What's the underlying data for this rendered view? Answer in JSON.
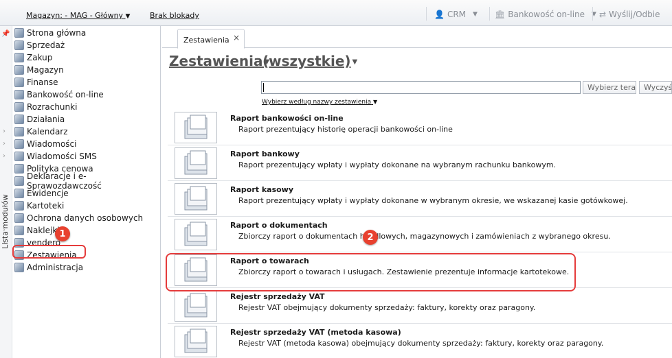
{
  "toolbar": {
    "warehouse_label": "Magazyn: - MAG - Główny",
    "lock_label": "Brak blokady",
    "crm_label": "CRM",
    "banking_label": "Bankowość on-line",
    "send_label": "Wyślij/Odbie"
  },
  "side_strip": {
    "label": "Lista modułów"
  },
  "sidebar": {
    "items": [
      {
        "label": "Strona główna"
      },
      {
        "label": "Sprzedaż"
      },
      {
        "label": "Zakup"
      },
      {
        "label": "Magazyn"
      },
      {
        "label": "Finanse"
      },
      {
        "label": "Bankowość on-line"
      },
      {
        "label": "Rozrachunki"
      },
      {
        "label": "Działania"
      },
      {
        "label": "Kalendarz"
      },
      {
        "label": "Wiadomości"
      },
      {
        "label": "Wiadomości SMS"
      },
      {
        "label": "Polityka cenowa"
      },
      {
        "label": "Deklaracje i e-Sprawozdawczość"
      },
      {
        "label": "Ewidencje"
      },
      {
        "label": "Kartoteki"
      },
      {
        "label": "Ochrona danych osobowych"
      },
      {
        "label": "Naklejki"
      },
      {
        "label": "vendero"
      },
      {
        "label": "Zestawienia"
      },
      {
        "label": "Administracja"
      }
    ]
  },
  "annotations": {
    "step1": "1",
    "step2": "2"
  },
  "tabs": {
    "active_label": "Zestawienia",
    "close_glyph": "×"
  },
  "header": {
    "title": "Zestawienia",
    "filter": "(wszystkie)"
  },
  "search": {
    "value": "",
    "select_button": "Wybierz teraz",
    "clear_button": "Wyczyść",
    "choose_by_name": "Wybierz według nazwy zestawienia"
  },
  "reports": [
    {
      "title": "Raport bankowości on-line",
      "desc": "Raport prezentujący historię operacji bankowości on-line"
    },
    {
      "title": "Raport bankowy",
      "desc": "Raport prezentujący wpłaty i wypłaty dokonane na wybranym rachunku bankowym."
    },
    {
      "title": "Raport kasowy",
      "desc": "Raport prezentujący wpłaty i wypłaty dokonane w wybranym okresie, we wskazanej kasie gotówkowej."
    },
    {
      "title": "Raport o dokumentach",
      "desc": "Zbiorczy raport o dokumentach handlowych, magazynowych i zamówieniach z wybranego okresu."
    },
    {
      "title": "Raport o towarach",
      "desc": "Zbiorczy raport o towarach i usługach. Zestawienie prezentuje informacje kartotekowe."
    },
    {
      "title": "Rejestr sprzedaży VAT",
      "desc": "Rejestr VAT obejmujący dokumenty sprzedaży: faktury, korekty oraz paragony."
    },
    {
      "title": "Rejestr sprzedaży VAT (metoda kasowa)",
      "desc": "Rejestr VAT (metoda kasowa) obejmujący dokumenty sprzedaży: faktury, korekty oraz paragony."
    }
  ]
}
